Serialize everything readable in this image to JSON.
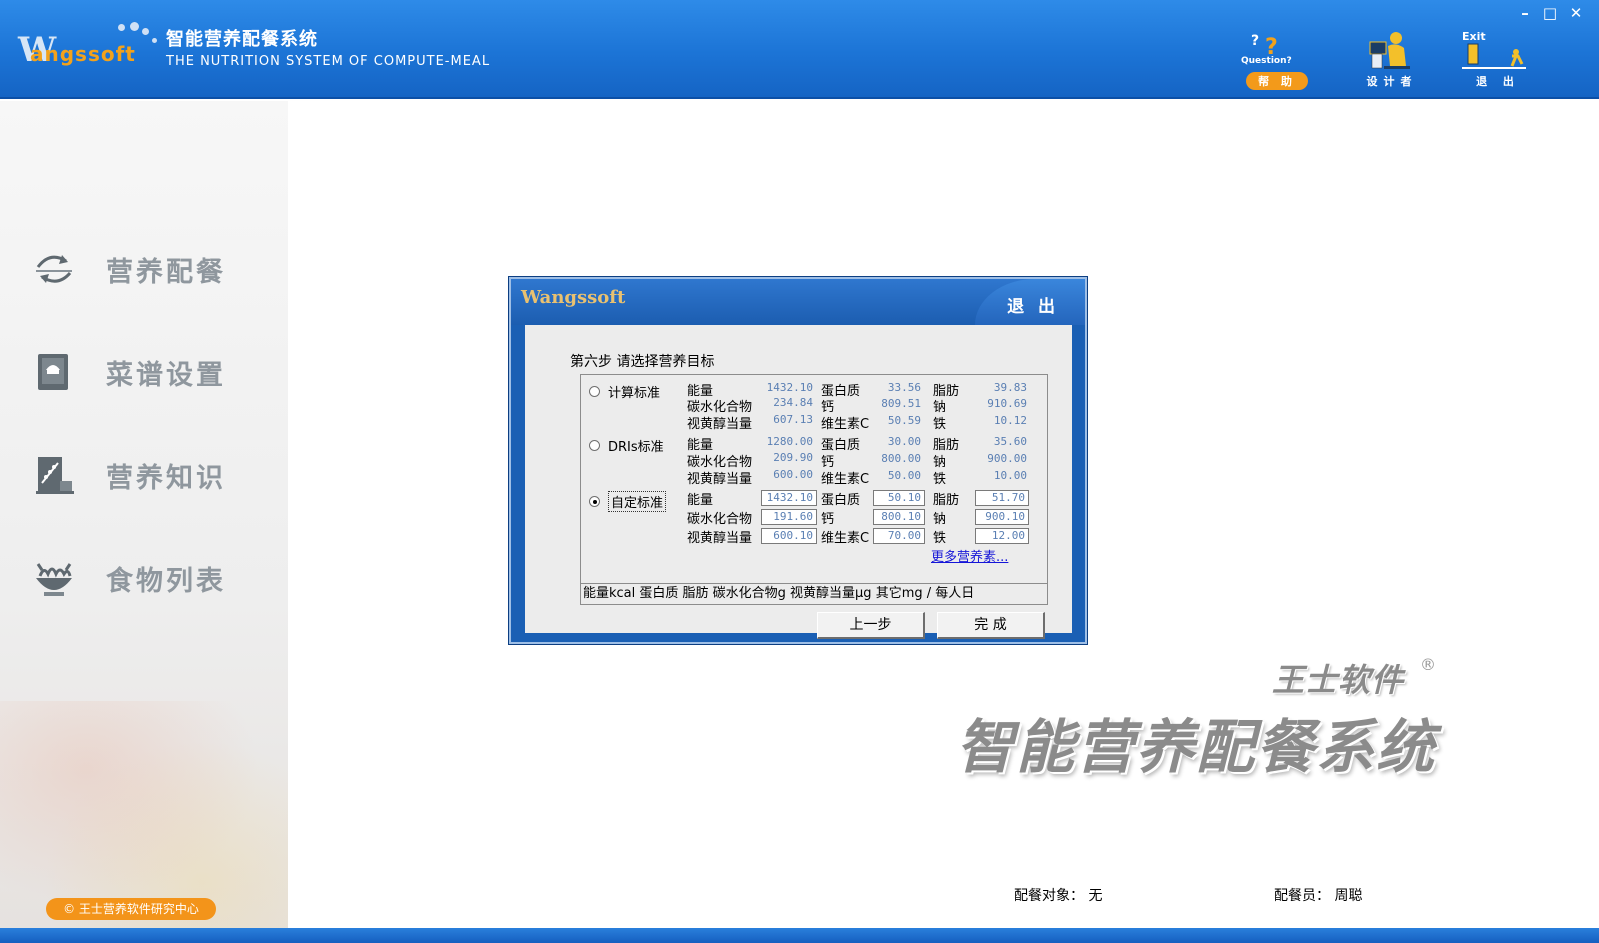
{
  "header": {
    "logo_w": "W",
    "logo_rest": "angssoft",
    "title": "智能营养配餐系统",
    "subtitle": "THE NUTRITION SYSTEM OF COMPUTE-MEAL",
    "tools": {
      "help_top": "Question?",
      "help_label": "帮 助",
      "designer_label": "设计者",
      "exit_top": "Exit",
      "exit_label": "退 出"
    },
    "window_controls": {
      "minimize": "–",
      "maximize": "□",
      "close": "✕"
    }
  },
  "sidebar": {
    "items": [
      {
        "label": "营养配餐",
        "icon": "recycle-icon"
      },
      {
        "label": "菜谱设置",
        "icon": "chef-book-icon"
      },
      {
        "label": "营养知识",
        "icon": "knowledge-icon"
      },
      {
        "label": "食物列表",
        "icon": "food-bowl-icon"
      }
    ],
    "copyright": "© 王士营养软件研究中心"
  },
  "dialog": {
    "logo": "Wangssoft",
    "exit_label": "退 出",
    "step_title": "第六步   请选择营养目标",
    "options": [
      {
        "label": "计算标准",
        "selected": false,
        "rows": [
          [
            {
              "name": "能量",
              "value": "1432.10"
            },
            {
              "name": "蛋白质",
              "value": "33.56"
            },
            {
              "name": "脂肪",
              "value": "39.83"
            }
          ],
          [
            {
              "name": "碳水化合物",
              "value": "234.84"
            },
            {
              "name": "钙",
              "value": "809.51"
            },
            {
              "name": "钠",
              "value": "910.69"
            }
          ],
          [
            {
              "name": "视黄醇当量",
              "value": "607.13"
            },
            {
              "name": "维生素C",
              "value": "50.59"
            },
            {
              "name": "铁",
              "value": "10.12"
            }
          ]
        ]
      },
      {
        "label": "DRIs标准",
        "selected": false,
        "rows": [
          [
            {
              "name": "能量",
              "value": "1280.00"
            },
            {
              "name": "蛋白质",
              "value": "30.00"
            },
            {
              "name": "脂肪",
              "value": "35.60"
            }
          ],
          [
            {
              "name": "碳水化合物",
              "value": "209.90"
            },
            {
              "name": "钙",
              "value": "800.00"
            },
            {
              "name": "钠",
              "value": "900.00"
            }
          ],
          [
            {
              "name": "视黄醇当量",
              "value": "600.00"
            },
            {
              "name": "维生素C",
              "value": "50.00"
            },
            {
              "name": "铁",
              "value": "10.00"
            }
          ]
        ]
      },
      {
        "label": "自定标准",
        "selected": true,
        "rows": [
          [
            {
              "name": "能量",
              "value": "1432.10"
            },
            {
              "name": "蛋白质",
              "value": "50.10"
            },
            {
              "name": "脂肪",
              "value": "51.70"
            }
          ],
          [
            {
              "name": "碳水化合物",
              "value": "191.60"
            },
            {
              "name": "钙",
              "value": "800.10"
            },
            {
              "name": "钠",
              "value": "900.10"
            }
          ],
          [
            {
              "name": "视黄醇当量",
              "value": "600.10"
            },
            {
              "name": "维生素C",
              "value": "70.00"
            },
            {
              "name": "铁",
              "value": "12.00"
            }
          ]
        ]
      }
    ],
    "more_link": "更多营养素...",
    "units": "能量kcal 蛋白质 脂肪 碳水化合物g 视黄醇当量μg 其它mg / 每人日",
    "prev_button": "上一步",
    "finish_button": "完 成"
  },
  "brand": {
    "company": "王士软件",
    "registered": "®",
    "product": "智能营养配餐系统"
  },
  "status": {
    "target": "配餐对象： 无",
    "operator": "配餐员： 周聪"
  }
}
